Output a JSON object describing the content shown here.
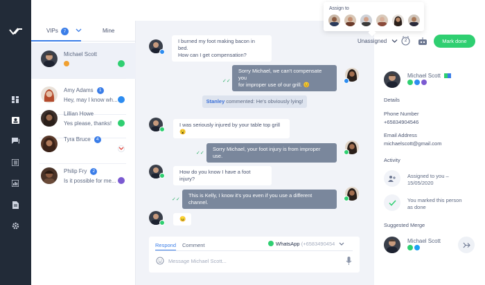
{
  "colors": {
    "rail": "#222b38",
    "accent": "#3a7de8",
    "whatsapp": "#2fcf71",
    "out_bubble": "#7a879c",
    "chat_bg": "#f1f3f8"
  },
  "sidebar": {
    "icons": [
      "logo-icon",
      "dashboard-icon",
      "contacts-icon",
      "chat-icon",
      "board-icon",
      "reports-icon",
      "documents-icon",
      "settings-icon"
    ]
  },
  "contacts": {
    "tabs": {
      "vips": "VIPs",
      "vips_count": "7",
      "mine": "Mine"
    },
    "items": [
      {
        "name": "Michael Scott",
        "badge": "",
        "message": "",
        "channel": "whatsapp"
      },
      {
        "name": "Amy Adams",
        "badge": "1",
        "message": "Hey, may I know wh...",
        "channel": "messenger"
      },
      {
        "name": "Lillian Howe",
        "badge": "",
        "message": "Yes please, thanks!",
        "channel": "whatsapp"
      },
      {
        "name": "Tyra Bruce",
        "badge": "4",
        "message": "",
        "channel": "gmail"
      },
      {
        "name": "Philip Fry",
        "badge": "2",
        "message": "Is it possible for me...",
        "channel": "viber"
      }
    ]
  },
  "header": {
    "assign_title": "Assign to",
    "status": "Unassigned",
    "counter": "2",
    "mark_done": "Mark done"
  },
  "chat": {
    "m1": "I burned my foot making bacon in bed.",
    "m1b": "How can I get compensation?",
    "m2": "Sorry Michael, we can't compensate you",
    "m2b": "for improper use of our grill. 😊",
    "note_name": "Stanley",
    "note_text": " commented: He's obviously lying!",
    "m3": "I was seriously injured by your table top grill 😮",
    "m4": "Sorry Michael, your foot injury is from improper use.",
    "m5": "How do you know I have a foot injury?",
    "m6": "This is Kelly, I know it's you even if you use a different channel.",
    "m7": "😠"
  },
  "composer": {
    "respond": "Respond",
    "comment": "Comment",
    "channel": "WhatsApp",
    "phone": "(+6583490454",
    "placeholder": "Message Michael Scott..."
  },
  "details": {
    "name": "Michael Scott",
    "details_title": "Details",
    "phone_label": "Phone Number",
    "phone": "+65834904546",
    "email_label": "Email Address",
    "email": "michaelscott@gmail.com",
    "activity_title": "Activity",
    "activity1": "Assigned to you –",
    "activity1b": "15/05/2020",
    "activity2": "You marked this person",
    "activity2b": "as done",
    "merge_title": "Suggested Merge",
    "merge_name": "Michael Scott"
  }
}
